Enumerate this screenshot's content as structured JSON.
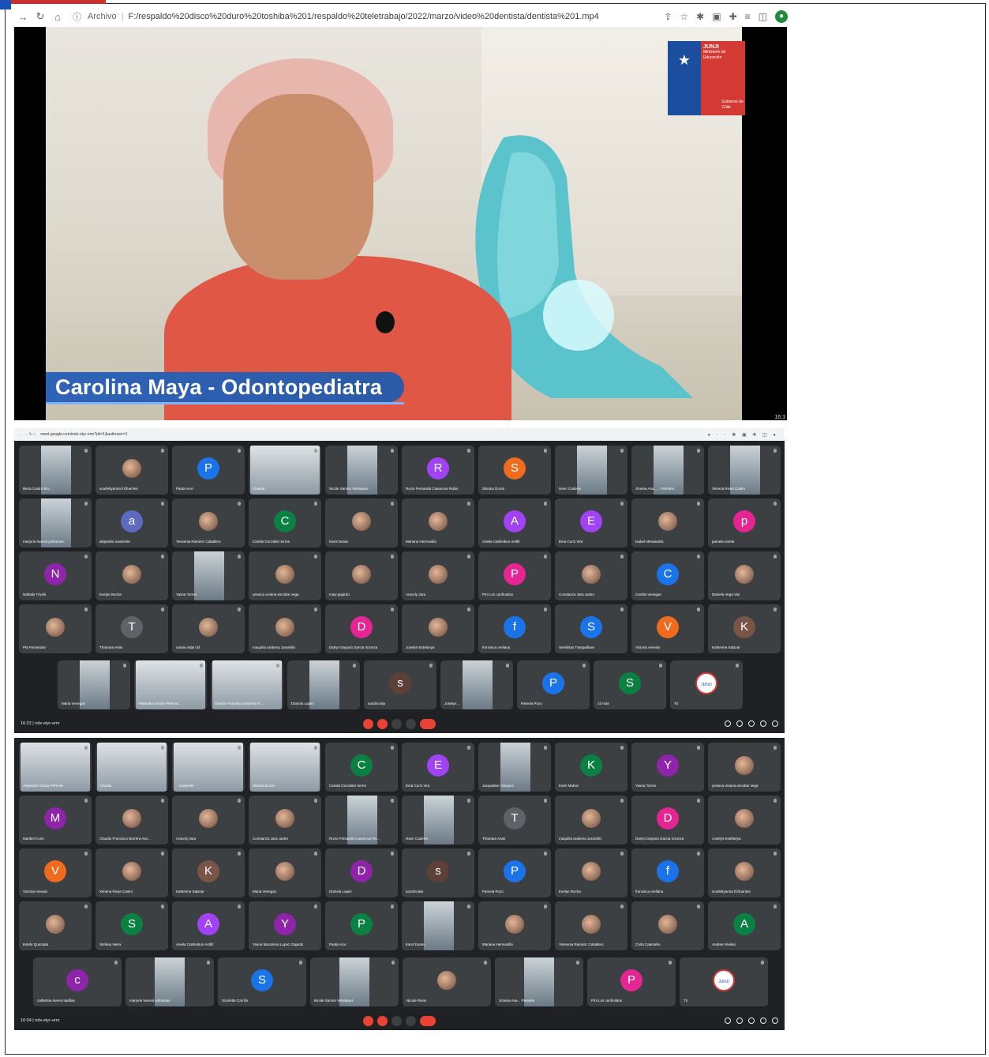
{
  "browser": {
    "file_label": "Archivo",
    "url": "F:/respaldo%20disco%20duro%20toshiba%201/respaldo%20teletrabajo/2022/marzo/video%20dentista/dentista%201.mp4"
  },
  "video": {
    "caption": "Carolina Maya - Odontopediatra",
    "time": "16:3",
    "logo": {
      "org": "JUNJI",
      "ministry": "Ministerio de Educación",
      "gov": "Gobierno de Chile"
    }
  },
  "meet1": {
    "url": "meet.google.com/nds-etyr-erm?pli=1&authuser=1",
    "time_code": "16:22  |  nds-etyr-erm",
    "tiles": [
      {
        "name": "Berta Castro Mu...",
        "kind": "video"
      },
      {
        "name": "scarlettyanira frizfuentes",
        "kind": "photo"
      },
      {
        "name": "Paola Arce",
        "kind": "avatar",
        "letter": "P",
        "color": "#1a73e8"
      },
      {
        "name": "Claudia",
        "kind": "video-wide"
      },
      {
        "name": "Nicole Santos Velasquez",
        "kind": "video"
      },
      {
        "name": "Rocio Fernanda Casanova Rubio",
        "kind": "avatar",
        "letter": "R",
        "color": "#a142f4"
      },
      {
        "name": "Silvana Duran",
        "kind": "avatar",
        "letter": "S",
        "color": "#f06b1d"
      },
      {
        "name": "Hann Cadena",
        "kind": "video"
      },
      {
        "name": "Jimena Ana... ...Paredes",
        "kind": "video"
      },
      {
        "name": "Ximena Rivas Castro",
        "kind": "video"
      },
      {
        "name": "marjorie huenul pichuman",
        "kind": "video"
      },
      {
        "name": "alejandra navarrete",
        "kind": "avatar",
        "letter": "a",
        "color": "#5c6bc0"
      },
      {
        "name": "Yessenia Ramirez Caballero",
        "kind": "photo"
      },
      {
        "name": "Camila González torres",
        "kind": "avatar",
        "letter": "C",
        "color": "#0b8043"
      },
      {
        "name": "Karol Duran",
        "kind": "photo"
      },
      {
        "name": "Mariana Hermosilla",
        "kind": "photo"
      },
      {
        "name": "Aniela Catrileibun Antifir",
        "kind": "avatar",
        "letter": "A",
        "color": "#a142f4"
      },
      {
        "name": "Ema Curin Vira",
        "kind": "avatar",
        "letter": "E",
        "color": "#a142f4"
      },
      {
        "name": "Isabel Alessandra",
        "kind": "photo"
      },
      {
        "name": "pamela varela",
        "kind": "avatar",
        "letter": "p",
        "color": "#e52592"
      },
      {
        "name": "Nathaly Trivick",
        "kind": "avatar",
        "letter": "N",
        "color": "#8e24aa"
      },
      {
        "name": "Evelyn Rocha",
        "kind": "photo"
      },
      {
        "name": "Yasna Torres",
        "kind": "video"
      },
      {
        "name": "yessica viviana escobar vega",
        "kind": "photo"
      },
      {
        "name": "mayi gajardo",
        "kind": "photo"
      },
      {
        "name": "Aracely Jara",
        "kind": "photo"
      },
      {
        "name": "Pmi Los cariñositos",
        "kind": "avatar",
        "letter": "P",
        "color": "#e52592"
      },
      {
        "name": "Constanza Jara castro",
        "kind": "photo"
      },
      {
        "name": "Camila Venegas",
        "kind": "avatar",
        "letter": "C",
        "color": "#1a73e8"
      },
      {
        "name": "Daniela Vega Vial",
        "kind": "photo"
      },
      {
        "name": "Pia Fernandez",
        "kind": "photo"
      },
      {
        "name": "Thamara Arias",
        "kind": "avatar",
        "letter": "T",
        "color": "#5f6368"
      },
      {
        "name": "urania vidal cid",
        "kind": "photo"
      },
      {
        "name": "maqulita arabena Jaramillo",
        "kind": "photo"
      },
      {
        "name": "Darlyn Dayana Garcia Inzunza",
        "kind": "avatar",
        "letter": "D",
        "color": "#e52592"
      },
      {
        "name": "Joselyn Estefanya",
        "kind": "photo"
      },
      {
        "name": "francisca orellana",
        "kind": "avatar",
        "letter": "f",
        "color": "#1a73e8"
      },
      {
        "name": "Semillitas Tranguilbom",
        "kind": "avatar",
        "letter": "S",
        "color": "#1a73e8"
      },
      {
        "name": "Victoria Arevalo",
        "kind": "avatar",
        "letter": "V",
        "color": "#f06b1d"
      },
      {
        "name": "Katherine Salazar",
        "kind": "avatar",
        "letter": "K",
        "color": "#795548"
      }
    ],
    "bottom_tiles": [
      {
        "name": "Maria Venegas",
        "kind": "video"
      },
      {
        "name": "Alejandra Oracia Peña M...",
        "kind": "video-wide"
      },
      {
        "name": "Claudio Francisco Barrera Ar...",
        "kind": "video-wide"
      },
      {
        "name": "Daniela Lopez",
        "kind": "video"
      },
      {
        "name": "sandra lala",
        "kind": "avatar",
        "letter": "s",
        "color": "#5d4037"
      },
      {
        "name": "Joselyn...",
        "kind": "video"
      },
      {
        "name": "Pamela Pozo",
        "kind": "avatar",
        "letter": "P",
        "color": "#1a73e8"
      },
      {
        "name": "13 más",
        "kind": "avatar",
        "letter": "S",
        "color": "#0b8043"
      },
      {
        "name": "Tú",
        "kind": "avatar",
        "letter": "JUNJI",
        "color": "#ffffff"
      }
    ]
  },
  "meet2": {
    "time_code": "16:04  |  nds-etyr-erm",
    "tiles": [
      {
        "name": "Alejandra Gracia Peña M...",
        "kind": "video-wide"
      },
      {
        "name": "Claudia",
        "kind": "video-wide"
      },
      {
        "name": "...navarrete",
        "kind": "video-wide"
      },
      {
        "name": "Silvana Duran",
        "kind": "video-wide"
      },
      {
        "name": "Camila González torres",
        "kind": "avatar",
        "letter": "C",
        "color": "#0b8043"
      },
      {
        "name": "Ema Curin Vira",
        "kind": "avatar",
        "letter": "E",
        "color": "#a142f4"
      },
      {
        "name": "Jacqueline Vasquez",
        "kind": "video"
      },
      {
        "name": "Karin Muñoz",
        "kind": "avatar",
        "letter": "K",
        "color": "#0b8043"
      },
      {
        "name": "Yasna Torres",
        "kind": "avatar",
        "letter": "Y",
        "color": "#8e24aa"
      },
      {
        "name": "yessica viviana escobar vega",
        "kind": "photo"
      },
      {
        "name": "Maribel Curin",
        "kind": "avatar",
        "letter": "M",
        "color": "#8e24aa"
      },
      {
        "name": "Claudio Francisco Barrera Aso...",
        "kind": "photo"
      },
      {
        "name": "Aracely Jara",
        "kind": "photo"
      },
      {
        "name": "Constanza Jara castro",
        "kind": "photo"
      },
      {
        "name": "Rocio Fernanda Casanova Ru...",
        "kind": "video"
      },
      {
        "name": "Hann Cadena",
        "kind": "video"
      },
      {
        "name": "Thamara Arias",
        "kind": "avatar",
        "letter": "T",
        "color": "#5f6368"
      },
      {
        "name": "maqulita arabena Jaramillo",
        "kind": "photo"
      },
      {
        "name": "Darlyn Dayana Garcia Inzunza",
        "kind": "avatar",
        "letter": "D",
        "color": "#e52592"
      },
      {
        "name": "Joselyn Estefanya",
        "kind": "photo"
      },
      {
        "name": "Victoria Arevalo",
        "kind": "avatar",
        "letter": "V",
        "color": "#f06b1d"
      },
      {
        "name": "Ximena Rivas Castro",
        "kind": "photo"
      },
      {
        "name": "Katherine Salazar",
        "kind": "avatar",
        "letter": "K",
        "color": "#795548"
      },
      {
        "name": "Maria Venegas",
        "kind": "photo"
      },
      {
        "name": "Daniela Lopez",
        "kind": "avatar",
        "letter": "D",
        "color": "#8e24aa"
      },
      {
        "name": "sandra lala",
        "kind": "avatar",
        "letter": "s",
        "color": "#5d4037"
      },
      {
        "name": "Pamela Pozo",
        "kind": "avatar",
        "letter": "P",
        "color": "#1a73e8"
      },
      {
        "name": "Evelyn Rocha",
        "kind": "photo"
      },
      {
        "name": "francisca orellana",
        "kind": "avatar",
        "letter": "f",
        "color": "#1a73e8"
      },
      {
        "name": "scarlettyanira frizfuentes",
        "kind": "photo"
      },
      {
        "name": "Estefy Quezada",
        "kind": "photo"
      },
      {
        "name": "Stefany Neira",
        "kind": "avatar",
        "letter": "S",
        "color": "#0b8043"
      },
      {
        "name": "Aniela Catrileibun Antifir",
        "kind": "avatar",
        "letter": "A",
        "color": "#a142f4"
      },
      {
        "name": "Yasna Macarena Lopez Gajardo",
        "kind": "avatar",
        "letter": "Y",
        "color": "#8e24aa"
      },
      {
        "name": "Paola Arce",
        "kind": "avatar",
        "letter": "P",
        "color": "#0b8043"
      },
      {
        "name": "Karol Duran",
        "kind": "video"
      },
      {
        "name": "Mariana Hermosilla",
        "kind": "photo"
      },
      {
        "name": "Yessenia Ramirez Caballero",
        "kind": "photo"
      },
      {
        "name": "Carla Caamaño",
        "kind": "photo"
      },
      {
        "name": "Andrea Yevilao",
        "kind": "avatar",
        "letter": "A",
        "color": "#0b8043"
      }
    ],
    "bottom_tiles": [
      {
        "name": "catherina rivera marillan",
        "kind": "avatar",
        "letter": "c",
        "color": "#8e24aa"
      },
      {
        "name": "marjorie huenul pichuman",
        "kind": "video"
      },
      {
        "name": "Scarlette Carrillo",
        "kind": "avatar",
        "letter": "S",
        "color": "#1a73e8"
      },
      {
        "name": "Nicole Santos Velasquez",
        "kind": "video"
      },
      {
        "name": "Nicole Rivas",
        "kind": "photo"
      },
      {
        "name": "Jimena Ana... Paredes",
        "kind": "video"
      },
      {
        "name": "Pmi Los cariñositos",
        "kind": "avatar",
        "letter": "P",
        "color": "#e52592"
      },
      {
        "name": "Tú",
        "kind": "avatar",
        "letter": "JUNJI",
        "color": "#ffffff"
      }
    ]
  }
}
